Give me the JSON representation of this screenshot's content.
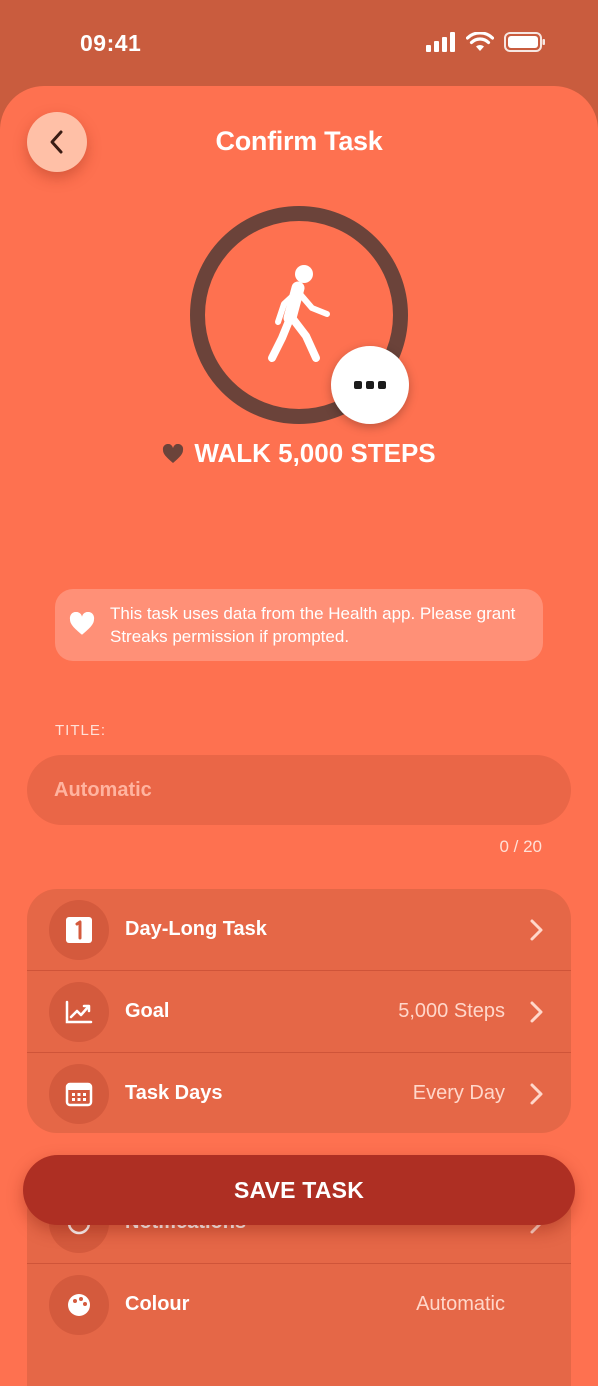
{
  "status_bar": {
    "time": "09:41"
  },
  "header": {
    "title": "Confirm Task"
  },
  "task": {
    "name": "WALK 5,000 STEPS"
  },
  "info_banner": {
    "text": "This task uses data from the Health app. Please grant Streaks permission if prompted."
  },
  "title_field": {
    "label": "TITLE:",
    "placeholder": "Automatic",
    "counter": "0 / 20"
  },
  "settings": [
    {
      "label": "Day-Long Task",
      "value": "",
      "icon": "day-long-task-icon"
    },
    {
      "label": "Goal",
      "value": "5,000 Steps",
      "icon": "chart-icon"
    },
    {
      "label": "Task Days",
      "value": "Every Day",
      "icon": "calendar-icon"
    }
  ],
  "settings_partial": [
    {
      "label": "Notifications",
      "icon": "bell-icon"
    },
    {
      "label": "Colour",
      "value": "Automatic",
      "icon": "palette-icon"
    }
  ],
  "actions": {
    "save_label": "SAVE TASK"
  },
  "colors": {
    "background": "#fe7150",
    "accent_dark": "#ae2f23",
    "ring": "#6b433a"
  }
}
